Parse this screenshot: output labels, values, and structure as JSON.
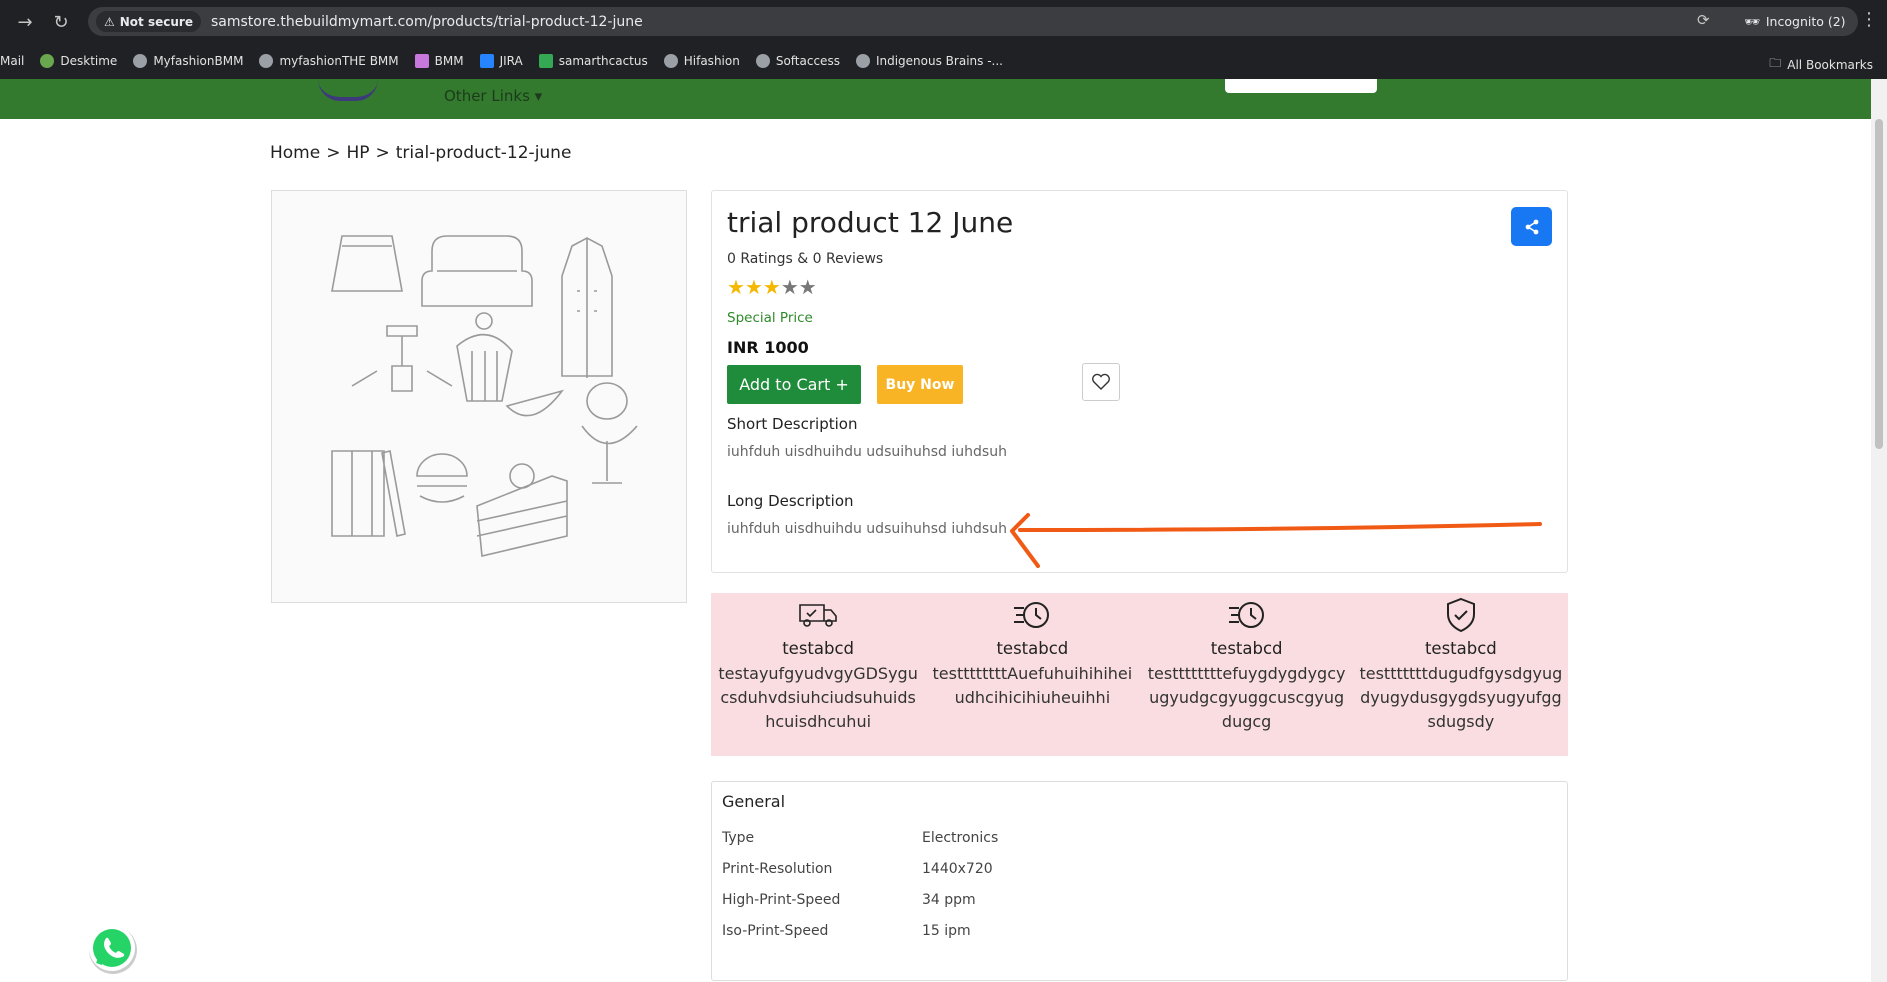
{
  "browser": {
    "security_label": "Not secure",
    "url": "samstore.thebuildmymart.com/products/trial-product-12-june",
    "incognito_label": "Incognito (2)",
    "bookmarks": [
      "Mail",
      "Desktime",
      "MyfashionBMM",
      "myfashionTHE BMM",
      "BMM",
      "JIRA",
      "samarthcactus",
      "Hifashion",
      "Softaccess",
      "Indigenous Brains -..."
    ],
    "all_bookmarks_label": "All Bookmarks"
  },
  "header": {
    "other_links": "Other Links ▾"
  },
  "breadcrumb": {
    "home": "Home",
    "sep1": ">",
    "category": "HP",
    "sep2": ">",
    "current": "trial-product-12-june"
  },
  "product": {
    "title": "trial product 12 June",
    "ratings_text": "0 Ratings & 0 Reviews",
    "rating": 3,
    "max_rating": 5,
    "special_label": "Special Price",
    "price": "INR 1000",
    "add_to_cart": "Add to Cart +",
    "buy_now": "Buy Now",
    "short_desc_head": "Short Description",
    "short_desc": "iuhfduh uisdhuihdu udsuihuhsd iuhdsuh",
    "long_desc_head": "Long Description",
    "long_desc": "iuhfduh uisdhuihdu udsuihuhsd iuhdsuh"
  },
  "features": [
    {
      "icon": "delivery-truck-icon",
      "title": "testabcd",
      "desc": "testayufgyudvgyGDSygucsduhvdsiuhciudsuhuidshcuisdhcuhui"
    },
    {
      "icon": "fast-clock-icon",
      "title": "testabcd",
      "desc": "testtttttttAuefuhuihihiheiudhcihicihiuheuihhi"
    },
    {
      "icon": "fast-clock-icon",
      "title": "testabcd",
      "desc": "testtttttttefuygdygdygcyugyudgcgyuggcuscgyugdugcg"
    },
    {
      "icon": "shield-check-icon",
      "title": "testabcd",
      "desc": "testttttttdugudfgysdgyugdyugydusgygdsyugyufggsdugsdy"
    }
  ],
  "general": {
    "title": "General",
    "specs": [
      {
        "key": "Type",
        "value": "Electronics"
      },
      {
        "key": "Print-Resolution",
        "value": "1440x720"
      },
      {
        "key": "High-Print-Speed",
        "value": "34 ppm"
      },
      {
        "key": "Iso-Print-Speed",
        "value": "15 ipm"
      }
    ]
  },
  "colors": {
    "header_green": "#337a2f",
    "cart_green": "#1e8c3a",
    "buy_yellow": "#f9b425",
    "share_blue": "#1877f2",
    "feature_bg": "#f9dde0",
    "annotation_arrow": "#f05a14"
  }
}
